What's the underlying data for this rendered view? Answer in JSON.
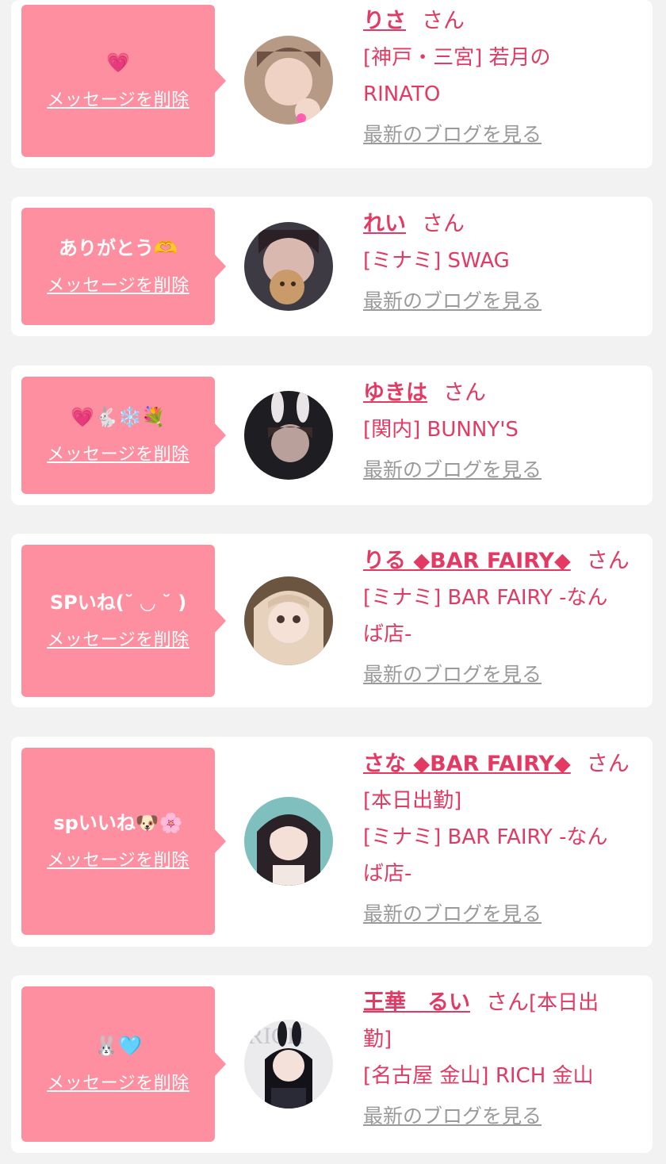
{
  "delete_label": "メッセージを削除",
  "blog_label": "最新のブログを見る",
  "san_label": "さん",
  "colors": {
    "bubble": "#fe8fa0",
    "accent": "#e23a63",
    "link_gray": "#9a9a9a"
  },
  "entries": [
    {
      "message": "💗",
      "name": "りさ",
      "shop_lines": [
        "[神戸・三宮] 若月の",
        "RINATO"
      ],
      "icon": "pink-heart-emoji"
    },
    {
      "message": "ありがとう🫶",
      "name": "れい",
      "shop_lines": [
        "[ミナミ] SWAG"
      ]
    },
    {
      "message": "💗🐇❄️💐",
      "name": "ゆきは",
      "shop_lines": [
        "[関内] BUNNY'S"
      ]
    },
    {
      "message": "SPいね(˘ ◡ ˘ )",
      "name": "りる ◆BAR FAIRY◆",
      "shop_lines": [
        "[ミナミ] BAR FAIRY -なん",
        "ば店-"
      ]
    },
    {
      "message": "spいいね🐶🌸",
      "name": "さな ◆BAR FAIRY◆",
      "shop_lines": [
        "[本日出勤]",
        "[ミナミ] BAR FAIRY -なん",
        "ば店-"
      ]
    },
    {
      "message": "🐰🩵",
      "name": "王華　るい",
      "after_san": "[本日出",
      "shop_lines": [
        "勤]",
        "[名古屋 金山] RICH 金山"
      ]
    }
  ]
}
